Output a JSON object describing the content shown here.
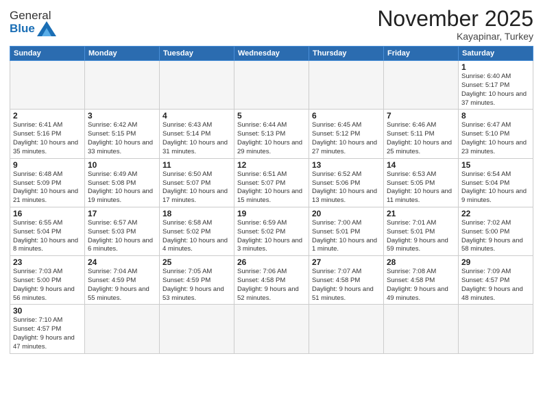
{
  "logo": {
    "text_general": "General",
    "text_blue": "Blue"
  },
  "header": {
    "month": "November 2025",
    "location": "Kayapinar, Turkey"
  },
  "weekdays": [
    "Sunday",
    "Monday",
    "Tuesday",
    "Wednesday",
    "Thursday",
    "Friday",
    "Saturday"
  ],
  "weeks": [
    [
      {
        "day": "",
        "info": ""
      },
      {
        "day": "",
        "info": ""
      },
      {
        "day": "",
        "info": ""
      },
      {
        "day": "",
        "info": ""
      },
      {
        "day": "",
        "info": ""
      },
      {
        "day": "",
        "info": ""
      },
      {
        "day": "1",
        "info": "Sunrise: 6:40 AM\nSunset: 5:17 PM\nDaylight: 10 hours\nand 37 minutes."
      }
    ],
    [
      {
        "day": "2",
        "info": "Sunrise: 6:41 AM\nSunset: 5:16 PM\nDaylight: 10 hours\nand 35 minutes."
      },
      {
        "day": "3",
        "info": "Sunrise: 6:42 AM\nSunset: 5:15 PM\nDaylight: 10 hours\nand 33 minutes."
      },
      {
        "day": "4",
        "info": "Sunrise: 6:43 AM\nSunset: 5:14 PM\nDaylight: 10 hours\nand 31 minutes."
      },
      {
        "day": "5",
        "info": "Sunrise: 6:44 AM\nSunset: 5:13 PM\nDaylight: 10 hours\nand 29 minutes."
      },
      {
        "day": "6",
        "info": "Sunrise: 6:45 AM\nSunset: 5:12 PM\nDaylight: 10 hours\nand 27 minutes."
      },
      {
        "day": "7",
        "info": "Sunrise: 6:46 AM\nSunset: 5:11 PM\nDaylight: 10 hours\nand 25 minutes."
      },
      {
        "day": "8",
        "info": "Sunrise: 6:47 AM\nSunset: 5:10 PM\nDaylight: 10 hours\nand 23 minutes."
      }
    ],
    [
      {
        "day": "9",
        "info": "Sunrise: 6:48 AM\nSunset: 5:09 PM\nDaylight: 10 hours\nand 21 minutes."
      },
      {
        "day": "10",
        "info": "Sunrise: 6:49 AM\nSunset: 5:08 PM\nDaylight: 10 hours\nand 19 minutes."
      },
      {
        "day": "11",
        "info": "Sunrise: 6:50 AM\nSunset: 5:07 PM\nDaylight: 10 hours\nand 17 minutes."
      },
      {
        "day": "12",
        "info": "Sunrise: 6:51 AM\nSunset: 5:07 PM\nDaylight: 10 hours\nand 15 minutes."
      },
      {
        "day": "13",
        "info": "Sunrise: 6:52 AM\nSunset: 5:06 PM\nDaylight: 10 hours\nand 13 minutes."
      },
      {
        "day": "14",
        "info": "Sunrise: 6:53 AM\nSunset: 5:05 PM\nDaylight: 10 hours\nand 11 minutes."
      },
      {
        "day": "15",
        "info": "Sunrise: 6:54 AM\nSunset: 5:04 PM\nDaylight: 10 hours\nand 9 minutes."
      }
    ],
    [
      {
        "day": "16",
        "info": "Sunrise: 6:55 AM\nSunset: 5:04 PM\nDaylight: 10 hours\nand 8 minutes."
      },
      {
        "day": "17",
        "info": "Sunrise: 6:57 AM\nSunset: 5:03 PM\nDaylight: 10 hours\nand 6 minutes."
      },
      {
        "day": "18",
        "info": "Sunrise: 6:58 AM\nSunset: 5:02 PM\nDaylight: 10 hours\nand 4 minutes."
      },
      {
        "day": "19",
        "info": "Sunrise: 6:59 AM\nSunset: 5:02 PM\nDaylight: 10 hours\nand 3 minutes."
      },
      {
        "day": "20",
        "info": "Sunrise: 7:00 AM\nSunset: 5:01 PM\nDaylight: 10 hours\nand 1 minute."
      },
      {
        "day": "21",
        "info": "Sunrise: 7:01 AM\nSunset: 5:01 PM\nDaylight: 9 hours\nand 59 minutes."
      },
      {
        "day": "22",
        "info": "Sunrise: 7:02 AM\nSunset: 5:00 PM\nDaylight: 9 hours\nand 58 minutes."
      }
    ],
    [
      {
        "day": "23",
        "info": "Sunrise: 7:03 AM\nSunset: 5:00 PM\nDaylight: 9 hours\nand 56 minutes."
      },
      {
        "day": "24",
        "info": "Sunrise: 7:04 AM\nSunset: 4:59 PM\nDaylight: 9 hours\nand 55 minutes."
      },
      {
        "day": "25",
        "info": "Sunrise: 7:05 AM\nSunset: 4:59 PM\nDaylight: 9 hours\nand 53 minutes."
      },
      {
        "day": "26",
        "info": "Sunrise: 7:06 AM\nSunset: 4:58 PM\nDaylight: 9 hours\nand 52 minutes."
      },
      {
        "day": "27",
        "info": "Sunrise: 7:07 AM\nSunset: 4:58 PM\nDaylight: 9 hours\nand 51 minutes."
      },
      {
        "day": "28",
        "info": "Sunrise: 7:08 AM\nSunset: 4:58 PM\nDaylight: 9 hours\nand 49 minutes."
      },
      {
        "day": "29",
        "info": "Sunrise: 7:09 AM\nSunset: 4:57 PM\nDaylight: 9 hours\nand 48 minutes."
      }
    ],
    [
      {
        "day": "30",
        "info": "Sunrise: 7:10 AM\nSunset: 4:57 PM\nDaylight: 9 hours\nand 47 minutes."
      },
      {
        "day": "",
        "info": ""
      },
      {
        "day": "",
        "info": ""
      },
      {
        "day": "",
        "info": ""
      },
      {
        "day": "",
        "info": ""
      },
      {
        "day": "",
        "info": ""
      },
      {
        "day": "",
        "info": ""
      }
    ]
  ]
}
